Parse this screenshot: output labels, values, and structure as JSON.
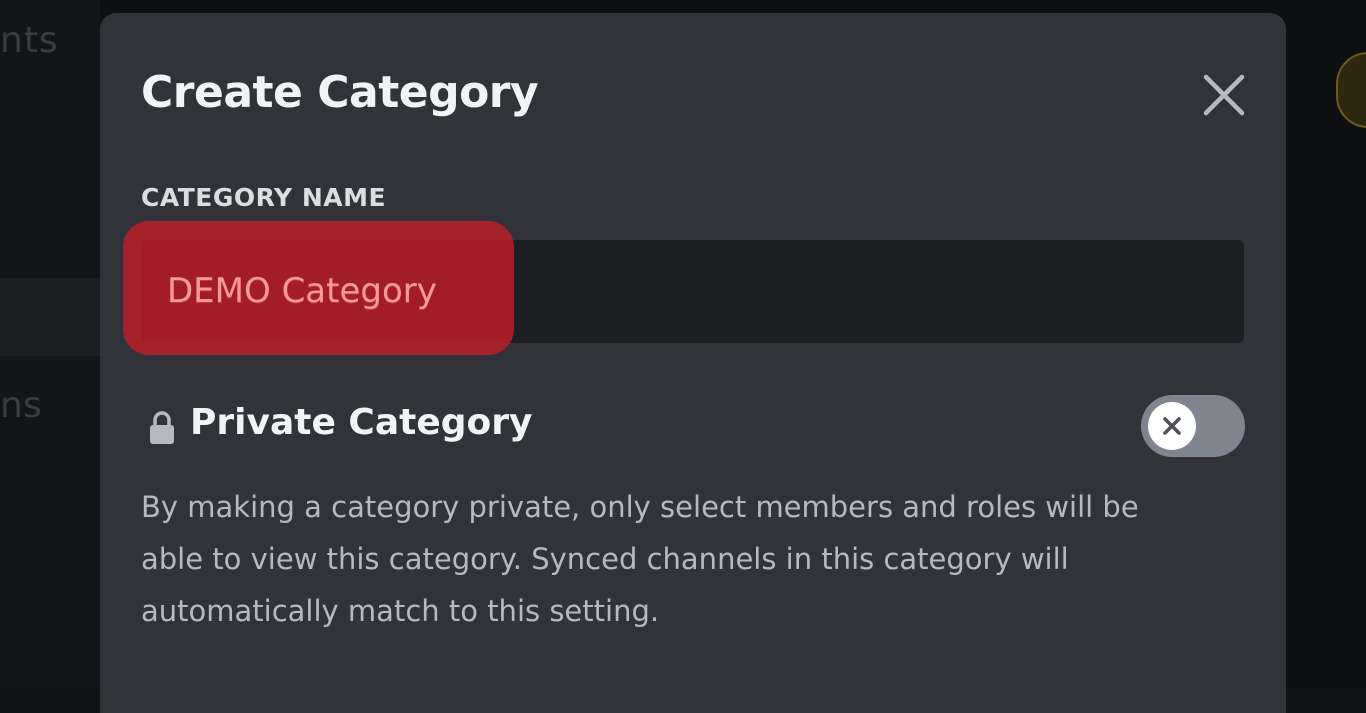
{
  "background": {
    "left_text_top": "nts",
    "left_text_bottom": "ns"
  },
  "modal": {
    "title": "Create Category",
    "close_icon": "close-icon"
  },
  "category_name": {
    "label": "CATEGORY NAME",
    "value": "DEMO Category",
    "highlight_color": "#c81e26"
  },
  "private_category": {
    "icon": "lock-icon",
    "label": "Private Category",
    "toggle_state": "off",
    "description": "By making a category private, only select members and roles will be able to view this category. Synced channels in this category will automatically match to this setting."
  },
  "colors": {
    "modal_bg": "#313338",
    "input_bg": "#1e1f22",
    "toggle_off": "#80848e",
    "title_text": "#f2f3f5",
    "muted_text": "#b5bac1"
  }
}
